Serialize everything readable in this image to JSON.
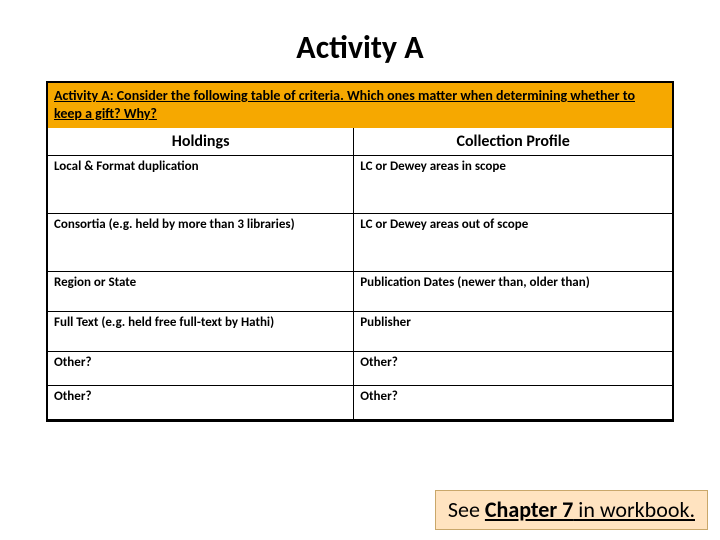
{
  "title": "Activity A",
  "prompt": "Activity A: Consider the following table of criteria. Which ones matter when determining whether to keep a gift? Why?",
  "headers": {
    "col1": "Holdings",
    "col2": "Collection Profile"
  },
  "rows": [
    {
      "c1": "Local & Format duplication",
      "c2": "LC or Dewey areas in scope"
    },
    {
      "c1": "Consortia (e.g. held by more than 3 libraries)",
      "c2": "LC or Dewey areas out of scope"
    },
    {
      "c1": "Region or State",
      "c2": "Publication Dates (newer than, older than)"
    },
    {
      "c1": "Full Text (e.g. held free full-text by Hathi)",
      "c2": "Publisher"
    },
    {
      "c1": "Other?",
      "c2": "Other?"
    },
    {
      "c1": "Other?",
      "c2": "Other?"
    }
  ],
  "footer": {
    "pre": "See ",
    "bold": "Chapter 7",
    "post": " in workbook."
  }
}
